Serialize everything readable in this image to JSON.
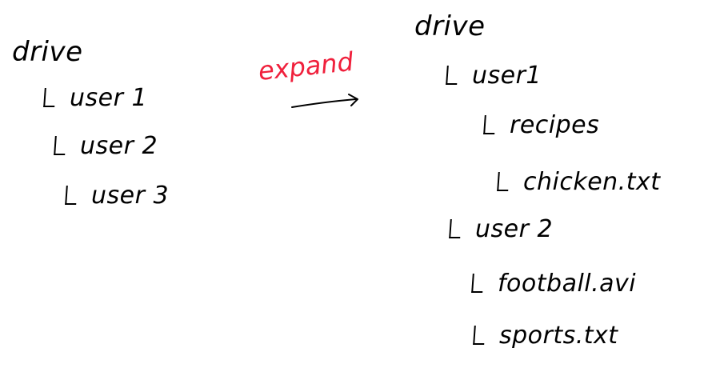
{
  "left_tree": {
    "root": "drive",
    "children": [
      "user 1",
      "user 2",
      "user 3"
    ]
  },
  "transition": {
    "label": "expand",
    "label_color": "#f0203c"
  },
  "right_tree": {
    "root": "drive",
    "user1": "user1",
    "recipes": "recipes",
    "chicken": "chicken.txt",
    "user2": "user 2",
    "football": "football.avi",
    "sports": "sports.txt"
  }
}
